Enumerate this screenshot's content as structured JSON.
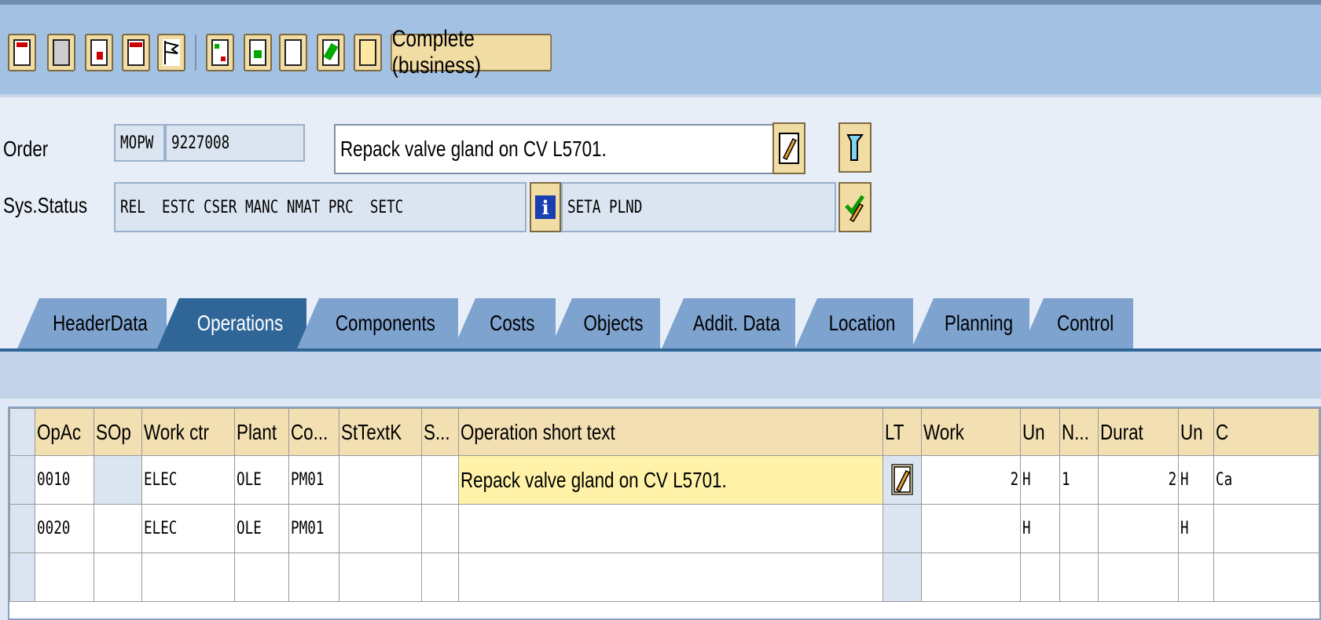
{
  "toolbar": {
    "buttons": [
      {
        "icon": "header-overview-icon"
      },
      {
        "icon": "calculator-icon"
      },
      {
        "icon": "cost-icon"
      },
      {
        "icon": "print-icon"
      },
      {
        "icon": "flag-icon"
      },
      {
        "icon": "network-icon"
      },
      {
        "icon": "copy-icon"
      },
      {
        "icon": "document-icon"
      },
      {
        "icon": "edit-check-icon"
      },
      {
        "icon": "clipboard-icon"
      }
    ],
    "complete_label": "Complete (business)"
  },
  "header": {
    "order_label": "Order",
    "order_type": "MOPW",
    "order_number": "9227008",
    "order_text": "Repack valve gland on CV L5701.",
    "sys_status_label": "Sys.Status",
    "sys_status": "REL  ESTC CSER MANC NMAT PRC  SETC",
    "user_status": "SETA PLND",
    "info_glyph": "i"
  },
  "tabs": [
    {
      "label": "HeaderData",
      "active": false
    },
    {
      "label": "Operations",
      "active": true
    },
    {
      "label": "Components",
      "active": false
    },
    {
      "label": "Costs",
      "active": false
    },
    {
      "label": "Objects",
      "active": false
    },
    {
      "label": "Addit. Data",
      "active": false
    },
    {
      "label": "Location",
      "active": false
    },
    {
      "label": "Planning",
      "active": false
    },
    {
      "label": "Control",
      "active": false
    }
  ],
  "operations": {
    "columns": [
      "OpAc",
      "SOp",
      "Work ctr",
      "Plant",
      "Co...",
      "StTextK",
      "S...",
      "Operation short text",
      "LT",
      "Work",
      "Un",
      "N...",
      "Durat",
      "Un",
      "C"
    ],
    "rows": [
      {
        "opac": "0010",
        "sop": "",
        "work_ctr": "ELEC",
        "plant": "OLE",
        "co": "PM01",
        "sttextk": "",
        "s": "",
        "short_text": "Repack valve gland on CV L5701.",
        "work": "2",
        "un": "H",
        "n": "1",
        "durat": "2",
        "un2": "H",
        "c": "Ca"
      },
      {
        "opac": "0020",
        "sop": "",
        "work_ctr": "ELEC",
        "plant": "OLE",
        "co": "PM01",
        "sttextk": "",
        "s": "",
        "short_text": "",
        "work": "",
        "un": "H",
        "n": "",
        "durat": "",
        "un2": "H",
        "c": ""
      }
    ]
  }
}
